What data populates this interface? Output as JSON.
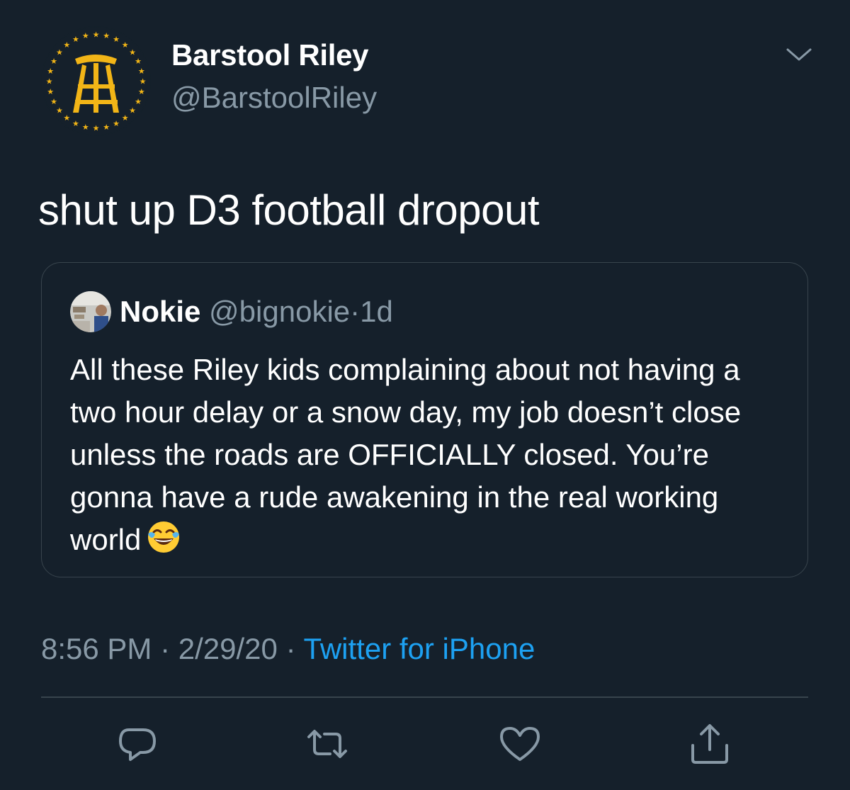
{
  "author": {
    "display_name": "Barstool Riley",
    "handle": "@BarstoolRiley"
  },
  "tweet": {
    "text": "shut up D3 football dropout"
  },
  "quoted_tweet": {
    "display_name": "Nokie",
    "handle": "@bignokie",
    "separator": "·",
    "time": "1d",
    "text": "All these Riley kids complaining about not having a two hour delay or a snow day, my job doesn’t close unless the roads are OFFICIALLY closed. You’re gonna have a rude awakening in the real working world",
    "emoji": "face-with-tears-of-joy"
  },
  "meta": {
    "time": "8:56 PM",
    "sep1": "·",
    "date": "2/29/20",
    "sep2": "·",
    "source": "Twitter for iPhone"
  },
  "actions": {
    "reply_icon": "reply-icon",
    "retweet_icon": "retweet-icon",
    "like_icon": "heart-icon",
    "share_icon": "share-icon"
  },
  "colors": {
    "background": "#15202b",
    "text": "#ffffff",
    "secondary": "#8899a6",
    "link": "#1da1f2",
    "border": "#38444d",
    "logo_gold": "#f2b517"
  }
}
